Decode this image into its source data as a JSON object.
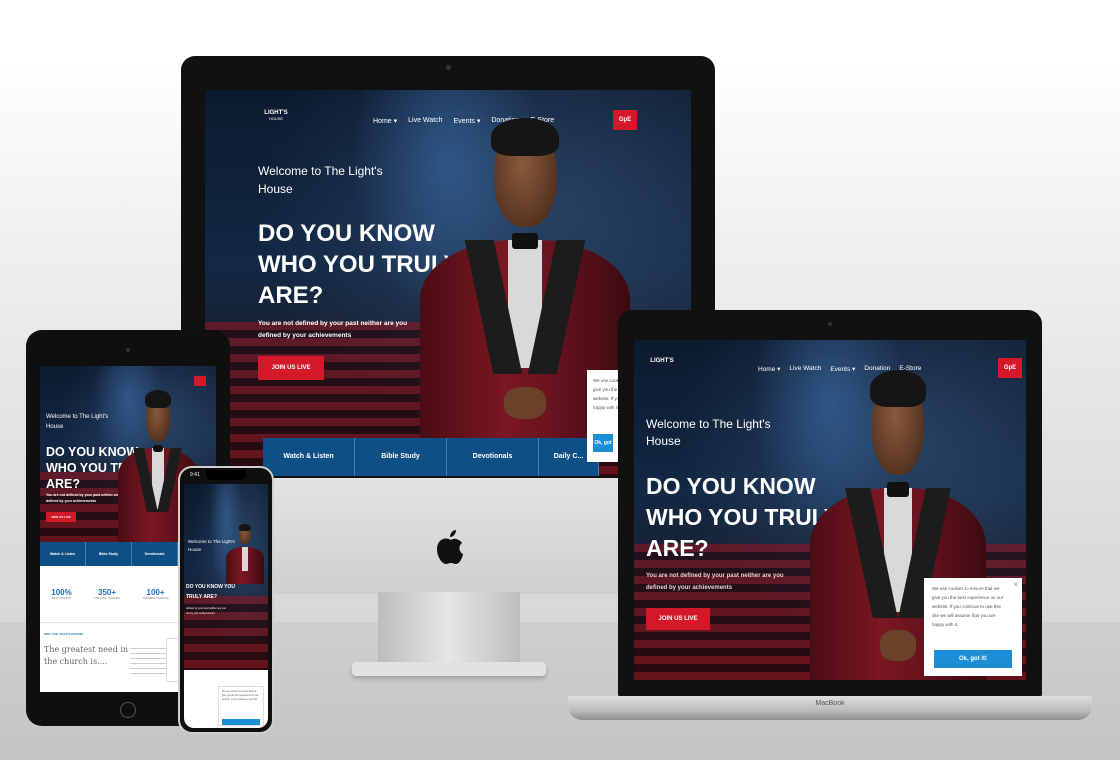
{
  "site": {
    "logo_text": "LIGHT'S",
    "logo_sub": "HOUSE",
    "nav": [
      "Home ▾",
      "Live Watch",
      "Events ▾",
      "Donation",
      "E-Store"
    ],
    "cta_small": "GpE",
    "welcome_line1": "Welcome to The Light's",
    "welcome_line2": "House",
    "headline_1": "DO YOU KNOW",
    "headline_2": "WHO YOU TRULY",
    "headline_3": "ARE?",
    "subtext_1": "You are not defined by your past neither are you",
    "subtext_2": "defined by your achievements",
    "join_button": "JOIN US LIVE",
    "tabs": [
      "Watch & Listen",
      "Bible Study",
      "Devotionals",
      "Daily C..."
    ],
    "cookie_lines": [
      "We use cookies to ensure that we",
      "give you the best experience on our",
      "website. If you continue to use this",
      "site we will assume that you are",
      "happy with it."
    ],
    "cookie_close": "×",
    "cookie_ok": "Ok, got it!"
  },
  "ipad": {
    "headline_1": "DO YOU KNOW",
    "headline_2": "WHO YOU TRULY",
    "headline_3": "ARE?",
    "welcome_line1": "Welcome to The Light's",
    "welcome_line2": "House",
    "subtext_1": "You are not defined by your past neither are you",
    "subtext_2": "defined by your achievements",
    "join_button": "JOIN US LIVE",
    "tabs": [
      "Watch & Listen",
      "Bible Study",
      "Devotionals"
    ],
    "stats": [
      {
        "value": "100%",
        "label": "DAILY WORSHIP"
      },
      {
        "value": "350+",
        "label": "FIVE-FOLD TEACHER"
      },
      {
        "value": "100+",
        "label": "THE BIBLE TEACHING"
      }
    ],
    "why_label": "WHY THE LIGHT'S HOUSE?",
    "greatest_1": "The greatest need in",
    "greatest_2": "the church is...."
  },
  "iphone": {
    "time": "9:41",
    "welcome_line1": "Welcome to The Light's",
    "welcome_line2": "House",
    "headline_1": "DO YOU KNOW YOU",
    "headline_2": "TRULY ARE?",
    "subtext_1": "defined by your past neither are you",
    "subtext_2": "our by your achievements"
  },
  "macbook": {
    "brand": "MacBook"
  }
}
